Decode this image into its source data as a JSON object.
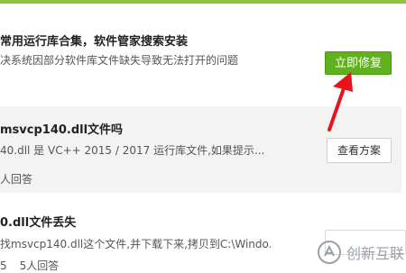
{
  "results": [
    {
      "title": "常用运行库合集，软件管家搜索安装",
      "desc": "决系统因部分软件库文件缺失导致无法打开的问题",
      "button": "立即修复"
    },
    {
      "title": "msvcp140.dll文件吗",
      "desc": "40.dll 是 VC++ 2015 / 2017 运行库文件,如果提示...",
      "meta": "人回答",
      "button": "查看方案"
    },
    {
      "title": "0.dll文件丢失",
      "desc": "找msvcp140.dll这个文件,并下载下来,拷贝到C:\\Windo...",
      "meta1": "5",
      "meta2": "5人回答"
    }
  ],
  "watermark": {
    "text": "创新互联",
    "icon": "brand-logo-icon"
  },
  "colors": {
    "accent_green": "#5fb11d",
    "arrow_red": "#e8141c",
    "card_gray": "#f3f3f3"
  }
}
